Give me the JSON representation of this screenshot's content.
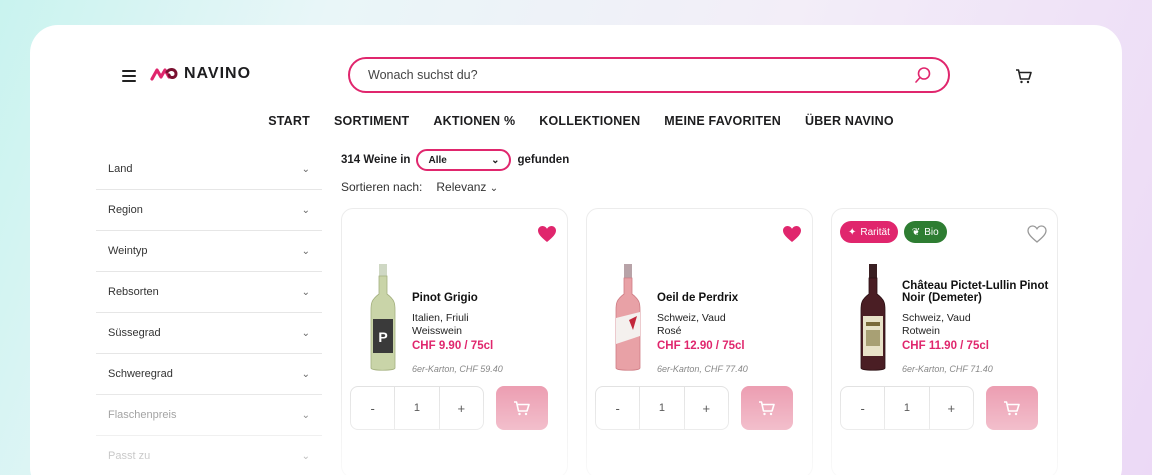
{
  "header": {
    "logo_text": "NAVINO",
    "search_placeholder": "Wonach suchst du?"
  },
  "nav": [
    "START",
    "SORTIMENT",
    "AKTIONEN %",
    "KOLLEKTIONEN",
    "MEINE FAVORITEN",
    "ÜBER NAVINO"
  ],
  "filters": [
    "Land",
    "Region",
    "Weintyp",
    "Rebsorten",
    "Süssegrad",
    "Schweregrad",
    "Flaschenpreis",
    "Passt zu"
  ],
  "results": {
    "count_text": "314 Weine in",
    "select_value": "Alle",
    "suffix": "gefunden",
    "sort_label": "Sortieren nach:",
    "sort_value": "Relevanz"
  },
  "products": [
    {
      "name": "Pinot Grigio",
      "region": "Italien, Friuli",
      "type": "Weisswein",
      "price": "CHF 9.90 / 75cl",
      "box": "6er-Karton, CHF 59.40",
      "qty": "1",
      "favorited": true,
      "badges": []
    },
    {
      "name": "Oeil de Perdrix",
      "region": "Schweiz, Vaud",
      "type": "Rosé",
      "price": "CHF 12.90 / 75cl",
      "box": "6er-Karton, CHF 77.40",
      "qty": "1",
      "favorited": true,
      "badges": []
    },
    {
      "name": "Château Pictet-Lullin Pinot Noir (Demeter)",
      "region": "Schweiz, Vaud",
      "type": "Rotwein",
      "price": "CHF 11.90 / 75cl",
      "box": "6er-Karton, CHF 71.40",
      "qty": "1",
      "favorited": false,
      "badges": [
        "Rarität",
        "Bio"
      ]
    }
  ],
  "qty_controls": {
    "minus": "-",
    "plus": "+"
  },
  "colors": {
    "accent": "#e0266d",
    "cart_button": "#ec9db1",
    "bio": "#2e7d32"
  },
  "icons": [
    "menu-icon",
    "logo-icon",
    "search-icon",
    "cart-icon",
    "chevron-down-icon",
    "heart-icon",
    "sparkle-icon",
    "leaf-icon"
  ]
}
